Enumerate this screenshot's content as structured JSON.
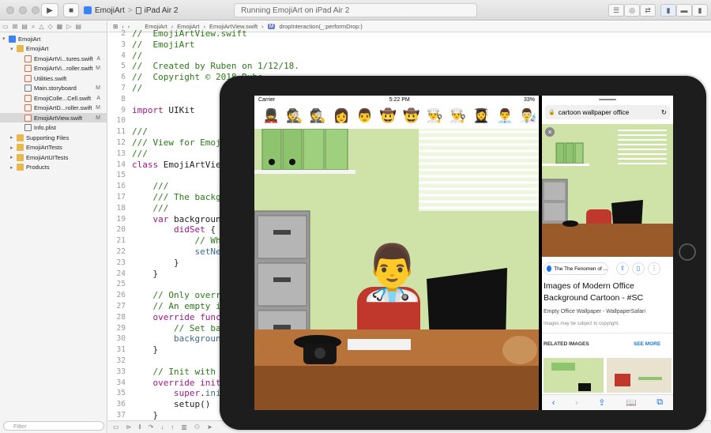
{
  "toolbar": {
    "scheme_app": "EmojiArt",
    "scheme_device": "iPad Air 2",
    "status": "Running EmojiArt on iPad Air 2",
    "separator": ">"
  },
  "navigator": {
    "items": [
      {
        "label": "EmojiArt",
        "status": "",
        "kind": "project",
        "indent": 0,
        "arrow": "▾"
      },
      {
        "label": "EmojiArt",
        "status": "",
        "kind": "folder",
        "indent": 1,
        "arrow": "▾"
      },
      {
        "label": "EmojiArtVi...tures.swift",
        "status": "A",
        "kind": "swift",
        "indent": 2,
        "arrow": ""
      },
      {
        "label": "EmojiArtVi...roller.swift",
        "status": "M",
        "kind": "swift",
        "indent": 2,
        "arrow": ""
      },
      {
        "label": "Utilities.swift",
        "status": "",
        "kind": "swift",
        "indent": 2,
        "arrow": ""
      },
      {
        "label": "Main.storyboard",
        "status": "M",
        "kind": "board",
        "indent": 2,
        "arrow": ""
      },
      {
        "label": "EmojiColle...Cell.swift",
        "status": "A",
        "kind": "swift",
        "indent": 2,
        "arrow": ""
      },
      {
        "label": "EmojiArtD...roller.swift",
        "status": "M",
        "kind": "swift",
        "indent": 2,
        "arrow": ""
      },
      {
        "label": "EmojiArtView.swift",
        "status": "M",
        "kind": "swift",
        "indent": 2,
        "arrow": "",
        "selected": true
      },
      {
        "label": "Info.plist",
        "status": "",
        "kind": "board",
        "indent": 2,
        "arrow": ""
      },
      {
        "label": "Supporting Files",
        "status": "",
        "kind": "folder",
        "indent": 1,
        "arrow": "▸"
      },
      {
        "label": "EmojiArtTests",
        "status": "",
        "kind": "folder",
        "indent": 1,
        "arrow": "▸"
      },
      {
        "label": "EmojiArtUITests",
        "status": "",
        "kind": "folder",
        "indent": 1,
        "arrow": "▸"
      },
      {
        "label": "Products",
        "status": "",
        "kind": "folder",
        "indent": 1,
        "arrow": "▸"
      }
    ],
    "filter_placeholder": "Filter"
  },
  "jumpbar": {
    "crumbs": [
      "EmojiArt",
      "EmojiArt",
      "EmojiArtView.swift",
      "dropInteraction(_:performDrop:)"
    ],
    "method_badge": "M"
  },
  "editor": {
    "lines": [
      {
        "n": "2",
        "html": "<span class='cm'>//  EmojiArtView.swift</span>"
      },
      {
        "n": "3",
        "html": "<span class='cm'>//  EmojiArt</span>"
      },
      {
        "n": "4",
        "html": "<span class='cm'>//</span>"
      },
      {
        "n": "5",
        "html": "<span class='cm'>//  Created by Ruben on 1/12/18.</span>"
      },
      {
        "n": "6",
        "html": "<span class='cm'>//  Copyright © 2018 Rube</span>"
      },
      {
        "n": "7",
        "html": "<span class='cm'>//</span>"
      },
      {
        "n": "8",
        "html": ""
      },
      {
        "n": "9",
        "html": "<span class='kw'>import</span> UIKit"
      },
      {
        "n": "10",
        "html": ""
      },
      {
        "n": "11",
        "html": "<span class='cm'>///</span>"
      },
      {
        "n": "12",
        "html": "<span class='cm'>/// View for Emoji</span>"
      },
      {
        "n": "13",
        "html": "<span class='cm'>///</span>"
      },
      {
        "n": "14",
        "html": "<span class='kw'>class</span> EmojiArtView"
      },
      {
        "n": "15",
        "html": ""
      },
      {
        "n": "16",
        "html": "    <span class='cm'>///</span>"
      },
      {
        "n": "17",
        "html": "    <span class='cm'>/// The backgr</span>"
      },
      {
        "n": "18",
        "html": "    <span class='cm'>///</span>"
      },
      {
        "n": "19",
        "html": "    <span class='kw'>var</span> background"
      },
      {
        "n": "20",
        "html": "        <span class='kw'>didSet</span> {"
      },
      {
        "n": "21",
        "html": "            <span class='cm'>// When</span>"
      },
      {
        "n": "22",
        "html": "            <span class='pl'>setNee</span>"
      },
      {
        "n": "23",
        "html": "        }"
      },
      {
        "n": "24",
        "html": "    }"
      },
      {
        "n": "25",
        "html": ""
      },
      {
        "n": "26",
        "html": "    <span class='cm'>// Only overri</span>"
      },
      {
        "n": "27",
        "html": "    <span class='cm'>// An empty im</span>"
      },
      {
        "n": "28",
        "html": "    <span class='kw'>override func</span>"
      },
      {
        "n": "29",
        "html": "        <span class='cm'>// Set bac</span>"
      },
      {
        "n": "30",
        "html": "        <span class='pl'>background</span>"
      },
      {
        "n": "31",
        "html": "    }"
      },
      {
        "n": "32",
        "html": ""
      },
      {
        "n": "33",
        "html": "    <span class='cm'>// Init with f</span>"
      },
      {
        "n": "34",
        "html": "    <span class='kw'>override init</span>("
      },
      {
        "n": "35",
        "html": "        <span class='kw'>super</span>.<span class='pl'>init</span>"
      },
      {
        "n": "36",
        "html": "        setup()"
      },
      {
        "n": "37",
        "html": "    }"
      }
    ]
  },
  "ipad": {
    "carrier": "Carrier",
    "time": "5:22 PM",
    "battery": "33%",
    "emoji_palette": [
      "💂",
      "🕵️",
      "🕵️",
      "👩",
      "👨",
      "🤠",
      "🤠",
      "👨‍🍳",
      "👨‍🍳",
      "👩‍🎓",
      "👨‍💼",
      "👨‍🔬"
    ],
    "worker_emoji": "👨‍⚕️",
    "safari": {
      "search": "cartoon wallpaper office",
      "source_label": "The The Fenomen of ...",
      "result_title": "Images of Modern Office Background Cartoon - #SC",
      "result_source": "Empty Office Wallpaper - WallpaperSafari",
      "copyright_note": "Images may be subject to copyright.",
      "related_label": "RELATED IMAGES",
      "see_more": "SEE MORE"
    }
  },
  "colors": {
    "comment": "#2a7a16",
    "keyword": "#a0168a",
    "wall": "#cfe2a8",
    "desk": "#9a5a2a",
    "link": "#1a73e8"
  }
}
